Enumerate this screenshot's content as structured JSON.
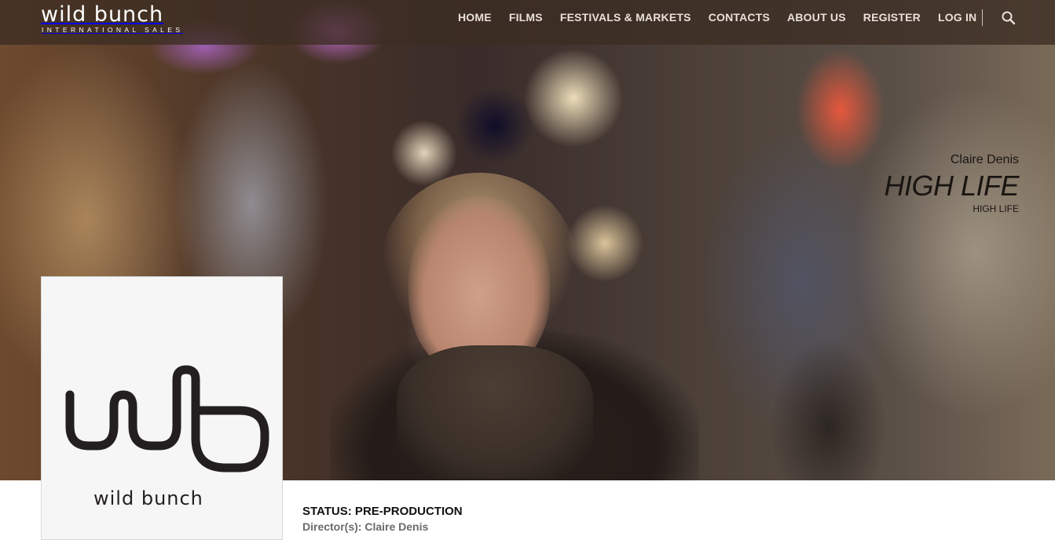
{
  "brand": {
    "logo_word": "wild bunch",
    "logo_subtitle": "INTERNATIONAL SALES",
    "poster_word": "wild bunch"
  },
  "nav": {
    "items": [
      {
        "label": "HOME"
      },
      {
        "label": "FILMS"
      },
      {
        "label": "FESTIVALS & MARKETS"
      },
      {
        "label": "CONTACTS"
      },
      {
        "label": "ABOUT US"
      },
      {
        "label": "REGISTER"
      },
      {
        "label": "LOG IN"
      }
    ],
    "search_icon": "search-icon"
  },
  "film": {
    "director": "Claire Denis",
    "title": "HIGH LIFE",
    "subtitle": "HIGH LIFE",
    "status": "STATUS: PRE-PRODUCTION",
    "directors_line": "Director(s): Claire Denis"
  },
  "colors": {
    "topbar": "#3c2d23",
    "nav_text": "#e8e0da",
    "title_text": "#1a1512",
    "logo_dark": "#231f20"
  }
}
